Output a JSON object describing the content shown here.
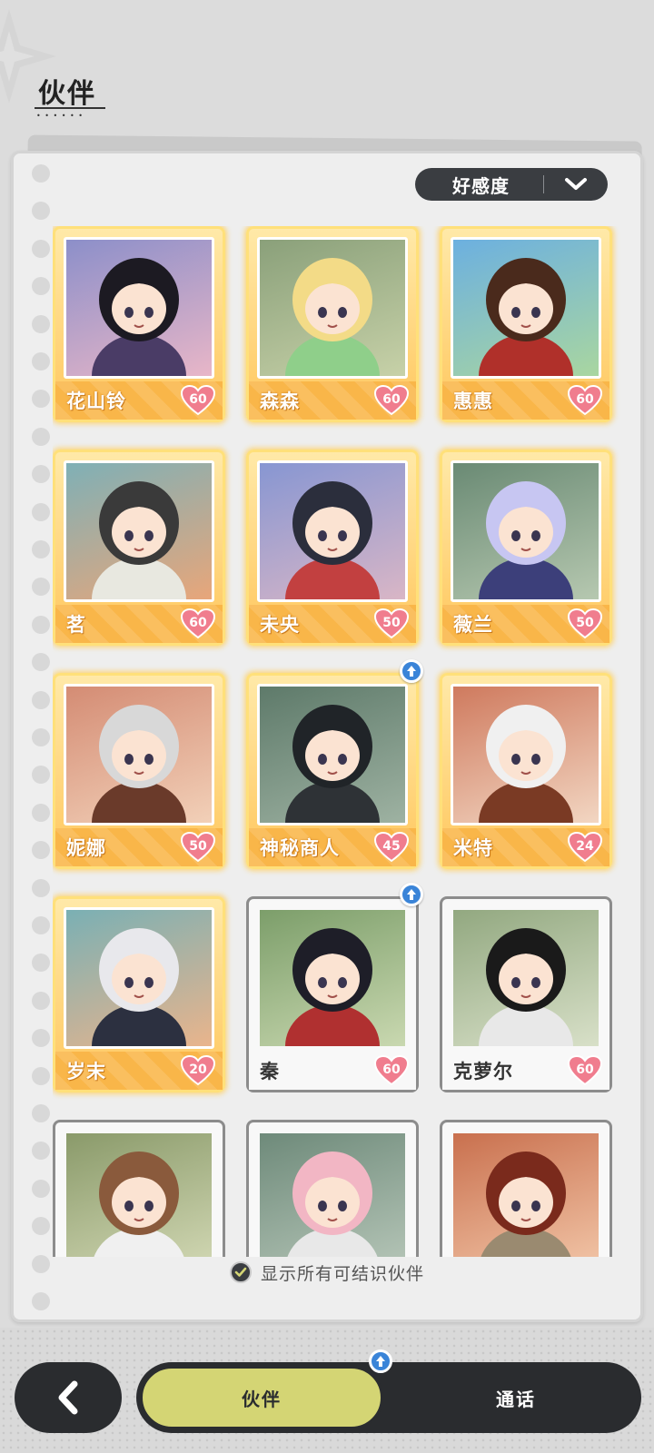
{
  "header": {
    "title": "伙伴"
  },
  "sort": {
    "label": "好感度"
  },
  "colors": {
    "gold_card": "#f9b649",
    "active_tab": "#d4d574",
    "dark": "#2a2c2f",
    "badge_blue": "#3a84d8",
    "heart": "#f07d8e"
  },
  "companions": [
    {
      "name": "花山铃",
      "affinity": "60",
      "style": "gold",
      "has_update": false,
      "bg": [
        "#8c8fc9",
        "#e8b6c8"
      ],
      "hair": "#1c1a22",
      "outfit": "#4a3c66"
    },
    {
      "name": "森森",
      "affinity": "60",
      "style": "gold",
      "has_update": false,
      "bg": [
        "#8aa07a",
        "#c7d1a8"
      ],
      "hair": "#f3db87",
      "outfit": "#8fcf8a"
    },
    {
      "name": "惠惠",
      "affinity": "60",
      "style": "gold",
      "has_update": false,
      "bg": [
        "#6cb0e0",
        "#a9d6a0"
      ],
      "hair": "#4a2a1c",
      "outfit": "#b0302a"
    },
    {
      "name": "茗",
      "affinity": "60",
      "style": "gold",
      "has_update": false,
      "bg": [
        "#7fb0b6",
        "#e8a67a"
      ],
      "hair": "#3a3a3a",
      "outfit": "#e8e8e0"
    },
    {
      "name": "未央",
      "affinity": "50",
      "style": "gold",
      "has_update": false,
      "bg": [
        "#8796d2",
        "#d9b6c6"
      ],
      "hair": "#2b2e3c",
      "outfit": "#c24040"
    },
    {
      "name": "薇兰",
      "affinity": "50",
      "style": "gold",
      "has_update": false,
      "bg": [
        "#6a8a74",
        "#b6c8b0"
      ],
      "hair": "#c7c6f2",
      "outfit": "#3c3f7a"
    },
    {
      "name": "妮娜",
      "affinity": "50",
      "style": "gold",
      "has_update": false,
      "bg": [
        "#d48c74",
        "#f2d0b8"
      ],
      "hair": "#d8d8d8",
      "outfit": "#6a3a2a"
    },
    {
      "name": "神秘商人",
      "affinity": "45",
      "style": "gold",
      "has_update": true,
      "bg": [
        "#5e7a6a",
        "#9eb2a2"
      ],
      "hair": "#202428",
      "outfit": "#2e3236"
    },
    {
      "name": "米特",
      "affinity": "24",
      "style": "gold",
      "has_update": false,
      "bg": [
        "#cf7a5e",
        "#f2d6c2"
      ],
      "hair": "#f0f0f0",
      "outfit": "#7a3a24"
    },
    {
      "name": "岁末",
      "affinity": "20",
      "style": "gold",
      "has_update": false,
      "bg": [
        "#7ab0b4",
        "#e9b48c"
      ],
      "hair": "#e8e8ec",
      "outfit": "#2c3040"
    },
    {
      "name": "秦",
      "affinity": "60",
      "style": "plain",
      "has_update": true,
      "bg": [
        "#7c9e6a",
        "#c9d8b0"
      ],
      "hair": "#1e1e28",
      "outfit": "#b03030"
    },
    {
      "name": "克萝尔",
      "affinity": "60",
      "style": "plain",
      "has_update": false,
      "bg": [
        "#92a880",
        "#d8e0c8"
      ],
      "hair": "#1a1a1a",
      "outfit": "#e8e8e8"
    },
    {
      "name": "",
      "affinity": "",
      "style": "plain",
      "has_update": false,
      "bg": [
        "#8a9a6a",
        "#d2d8b4"
      ],
      "hair": "#8a5a3c",
      "outfit": "#f0f0f0"
    },
    {
      "name": "",
      "affinity": "",
      "style": "plain",
      "has_update": false,
      "bg": [
        "#6e8a7a",
        "#b6c6b8"
      ],
      "hair": "#f2b6c4",
      "outfit": "#e8e8e8"
    },
    {
      "name": "",
      "affinity": "",
      "style": "plain",
      "has_update": false,
      "bg": [
        "#c9704e",
        "#f2c6a8"
      ],
      "hair": "#7a2a1c",
      "outfit": "#9a8a70"
    }
  ],
  "filter": {
    "label": "显示所有可结识伙伴",
    "checked": true
  },
  "nav": {
    "back_icon": "chevron-left-icon",
    "tabs": [
      {
        "label": "伙伴",
        "active": true,
        "has_update": true
      },
      {
        "label": "通话",
        "active": false,
        "has_update": false
      }
    ]
  }
}
